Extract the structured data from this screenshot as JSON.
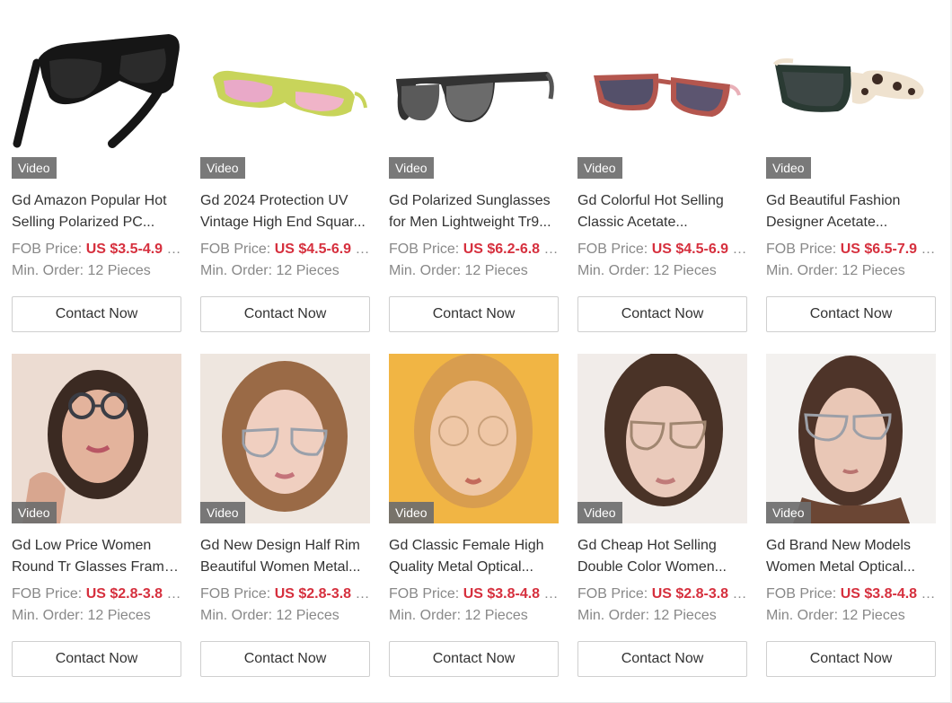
{
  "products": [
    {
      "title_lines": [
        "Gd Amazon Popular Hot",
        "Selling Polarized PC..."
      ],
      "price_label": "FOB Price:",
      "price": "US $3.5-4.9",
      "price_suffix": "/...",
      "moq": "Min. Order: 12 Pieces",
      "badge": "Video",
      "button": "Contact Now"
    },
    {
      "title_lines": [
        "Gd 2024 Protection UV",
        "Vintage High End Squar..."
      ],
      "price_label": "FOB Price:",
      "price": "US $4.5-6.9",
      "price_suffix": "/...",
      "moq": "Min. Order: 12 Pieces",
      "badge": "Video",
      "button": "Contact Now"
    },
    {
      "title_lines": [
        "Gd Polarized Sunglasses",
        "for Men Lightweight Tr9..."
      ],
      "price_label": "FOB Price:",
      "price": "US $6.2-6.8",
      "price_suffix": "/...",
      "moq": "Min. Order: 12 Pieces",
      "badge": "Video",
      "button": "Contact Now"
    },
    {
      "title_lines": [
        "Gd Colorful Hot Selling",
        "Classic Acetate..."
      ],
      "price_label": "FOB Price:",
      "price": "US $4.5-6.9",
      "price_suffix": "/...",
      "moq": "Min. Order: 12 Pieces",
      "badge": "Video",
      "button": "Contact Now"
    },
    {
      "title_lines": [
        "Gd Beautiful Fashion",
        "Designer Acetate..."
      ],
      "price_label": "FOB Price:",
      "price": "US $6.5-7.9",
      "price_suffix": "/...",
      "moq": "Min. Order: 12 Pieces",
      "badge": "Video",
      "button": "Contact Now"
    },
    {
      "title_lines": [
        "Gd Low Price Women",
        "Round Tr Glasses Frame..."
      ],
      "price_label": "FOB Price:",
      "price": "US $2.8-3.8",
      "price_suffix": "/...",
      "moq": "Min. Order: 12 Pieces",
      "badge": "Video",
      "button": "Contact Now"
    },
    {
      "title_lines": [
        "Gd New Design Half Rim",
        "Beautiful Women Metal..."
      ],
      "price_label": "FOB Price:",
      "price": "US $2.8-3.8",
      "price_suffix": "/...",
      "moq": "Min. Order: 12 Pieces",
      "badge": "Video",
      "button": "Contact Now"
    },
    {
      "title_lines": [
        "Gd Classic Female High",
        "Quality Metal Optical..."
      ],
      "price_label": "FOB Price:",
      "price": "US $3.8-4.8",
      "price_suffix": "/...",
      "moq": "Min. Order: 12 Pieces",
      "badge": "Video",
      "button": "Contact Now"
    },
    {
      "title_lines": [
        "Gd Cheap Hot Selling",
        "Double Color Women..."
      ],
      "price_label": "FOB Price:",
      "price": "US $2.8-3.8",
      "price_suffix": "/...",
      "moq": "Min. Order: 12 Pieces",
      "badge": "Video",
      "button": "Contact Now"
    },
    {
      "title_lines": [
        "Gd Brand New Models",
        "Women Metal Optical..."
      ],
      "price_label": "FOB Price:",
      "price": "US $3.8-4.8",
      "price_suffix": "/...",
      "moq": "Min. Order: 12 Pieces",
      "badge": "Video",
      "button": "Contact Now"
    }
  ],
  "colors": {
    "price": "#d6303e",
    "muted_text": "#888888",
    "badge_bg": "#6e6e6e",
    "button_border": "#cfcfcf"
  }
}
